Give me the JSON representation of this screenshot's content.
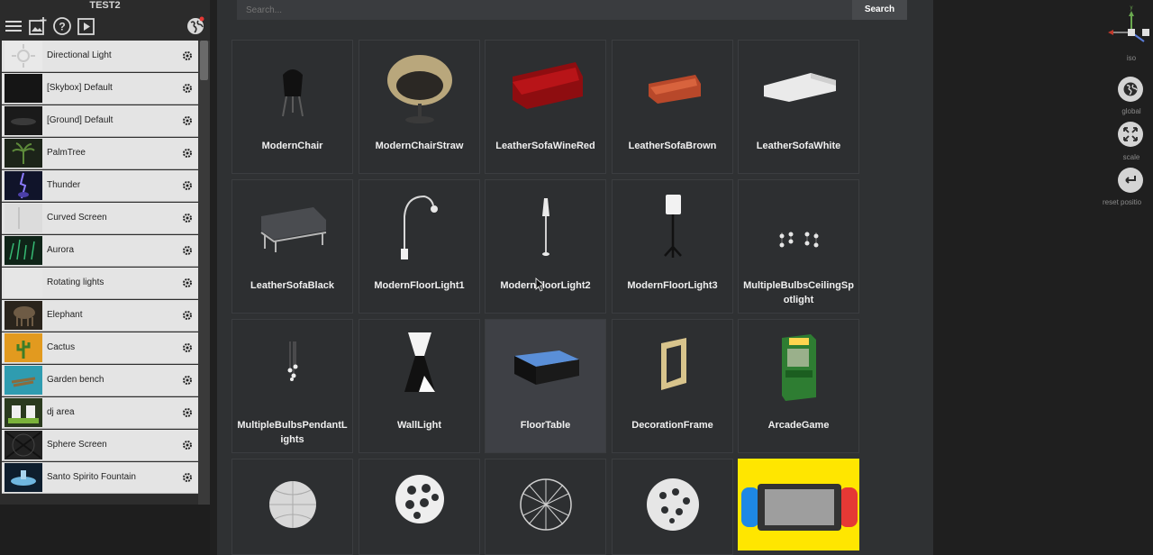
{
  "project": {
    "title": "TEST2"
  },
  "toolbar": {
    "icons": [
      "menu-icon",
      "add-image-icon",
      "help-icon",
      "play-icon",
      "globe-icon"
    ]
  },
  "scene_list": [
    {
      "label": "Directional Light",
      "thumb": "#efefef"
    },
    {
      "label": "[Skybox] Default",
      "thumb": "#151515"
    },
    {
      "label": "[Ground] Default",
      "thumb": "#1a1a1a"
    },
    {
      "label": "PalmTree",
      "thumb": "#1e2a1a"
    },
    {
      "label": "Thunder",
      "thumb": "#12162a"
    },
    {
      "label": "Curved Screen",
      "thumb": "#e0e0e0"
    },
    {
      "label": "Aurora",
      "thumb": "#0f2418"
    },
    {
      "label": "Rotating lights",
      "thumb": "#e6e6e6"
    },
    {
      "label": "Elephant",
      "thumb": "#2a241c"
    },
    {
      "label": "Cactus",
      "thumb": "#e29a1f"
    },
    {
      "label": "Garden bench",
      "thumb": "#2f9cb0"
    },
    {
      "label": "dj area",
      "thumb": "#2a3a1e"
    },
    {
      "label": "Sphere Screen",
      "thumb": "#222222"
    },
    {
      "label": "Santo Spirito Fountain",
      "thumb": "#0e1e2e"
    }
  ],
  "search": {
    "placeholder": "Search...",
    "button": "Search"
  },
  "assets": [
    {
      "label": "ModernChair"
    },
    {
      "label": "ModernChairStraw"
    },
    {
      "label": "LeatherSofaWineRed"
    },
    {
      "label": "LeatherSofaBrown"
    },
    {
      "label": "LeatherSofaWhite"
    },
    {
      "label": "LeatherSofaBlack"
    },
    {
      "label": "ModernFloorLight1"
    },
    {
      "label": "ModernFloorLight2"
    },
    {
      "label": "ModernFloorLight3"
    },
    {
      "label": "MultipleBulbsCeilingSpotlight"
    },
    {
      "label": "MultipleBulbsPendantLights"
    },
    {
      "label": "WallLight"
    },
    {
      "label": "FloorTable"
    },
    {
      "label": "DecorationFrame"
    },
    {
      "label": "ArcadeGame"
    }
  ],
  "gizmo": {
    "view_label": "iso",
    "buttons": [
      {
        "label": "global",
        "icon": "globe-icon"
      },
      {
        "label": "scale",
        "icon": "expand-icon"
      },
      {
        "label": "reset positio",
        "icon": "reset-icon"
      }
    ]
  }
}
